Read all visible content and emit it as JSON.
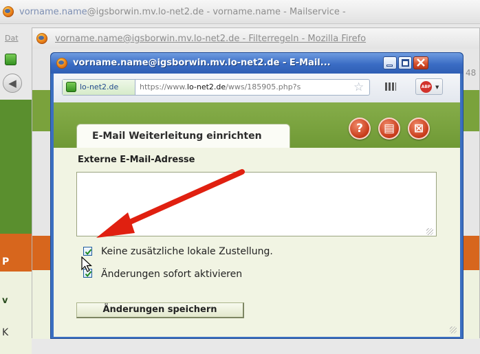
{
  "back_window": {
    "title_prefix": "vorname.name",
    "title_rest": "@igsborwin.mv.lo-net2.de - vorname.name - Mailservice -",
    "menu_fragment": "Dat"
  },
  "middle_window": {
    "title": "vorname.name@igsborwin.mv.lo-net2.de - Filterregeln - Mozilla Firefo",
    "side_number": "48"
  },
  "popup": {
    "title": "vorname.name@igsborwin.mv.lo-net2.de - E-Mail...",
    "url_site": "lo-net2.de",
    "url_prefix": "https://www.",
    "url_domain": "lo-net2.de",
    "url_path": "/wws/185905.php?s",
    "abp_label": "ABP",
    "tab_title": "E-Mail Weiterleitung einrichten",
    "field_label": "Externe E-Mail-Adresse",
    "email_value": "",
    "checkbox1_label": "Keine zusätzliche lokale Zustellung.",
    "checkbox1_checked": true,
    "checkbox2_label": "Änderungen sofort aktivieren",
    "checkbox2_checked": true,
    "save_label": "Änderungen speichern",
    "help_glyph": "?",
    "print_glyph": "▤",
    "close_glyph": "⊠"
  },
  "background_page": {
    "left_p": "P",
    "left_v": "v",
    "left_k": "K"
  },
  "colors": {
    "green_header": "#7aa23c",
    "panel_bg": "#f1f4e3",
    "accent_red": "#d43a1a",
    "window_border": "#3b6fc1"
  }
}
